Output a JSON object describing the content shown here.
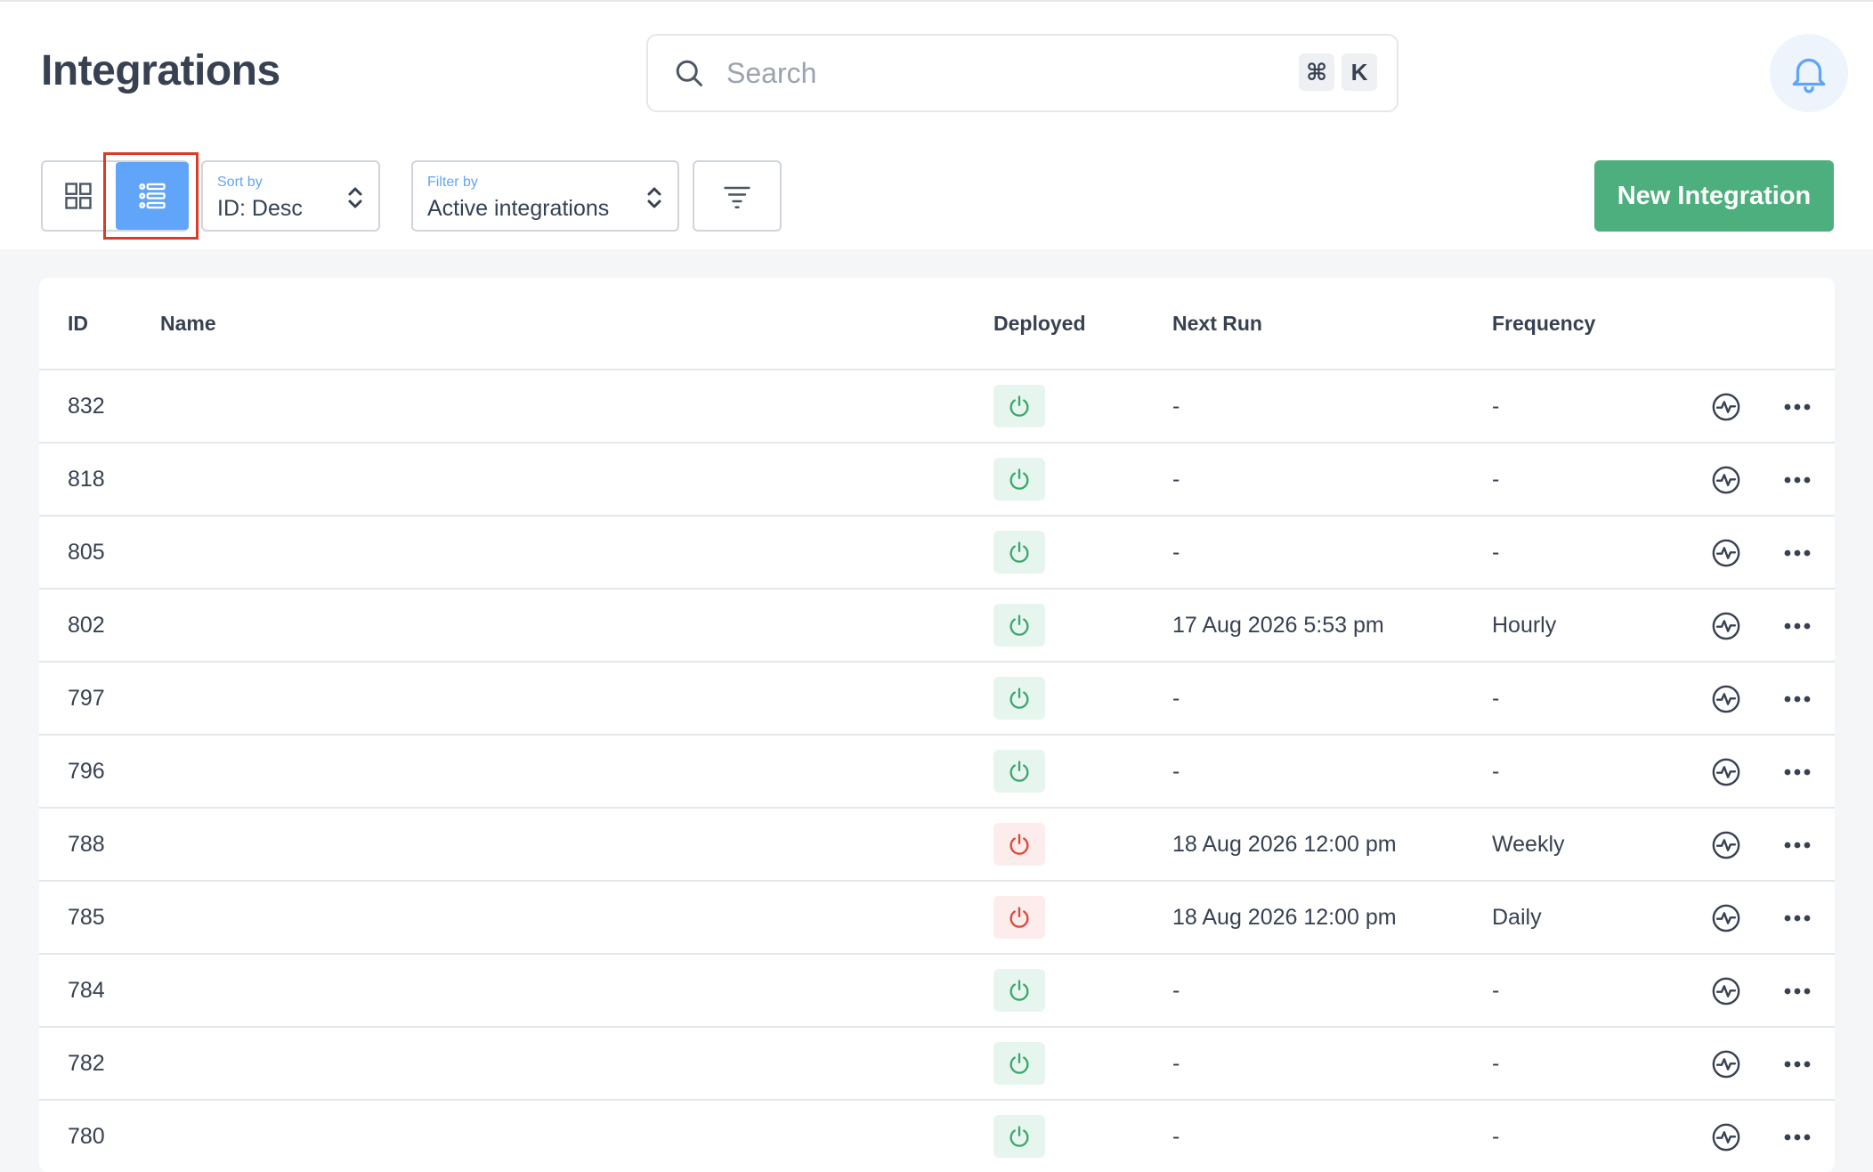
{
  "header": {
    "title": "Integrations",
    "search": {
      "placeholder": "Search",
      "value": "",
      "shortcut_keys": [
        "⌘",
        "K"
      ]
    }
  },
  "toolbar": {
    "view_modes": [
      "grid",
      "list"
    ],
    "active_view": "list",
    "sort": {
      "label": "Sort by",
      "value": "ID: Desc"
    },
    "filter": {
      "label": "Filter by",
      "value": "Active integrations"
    },
    "new_button_label": "New Integration"
  },
  "table": {
    "columns": [
      "ID",
      "Name",
      "Deployed",
      "Next Run",
      "Frequency"
    ],
    "rows": [
      {
        "id": "832",
        "name": "",
        "deployed": true,
        "next_run": "-",
        "frequency": "-"
      },
      {
        "id": "818",
        "name": "",
        "deployed": true,
        "next_run": "-",
        "frequency": "-"
      },
      {
        "id": "805",
        "name": "",
        "deployed": true,
        "next_run": "-",
        "frequency": "-"
      },
      {
        "id": "802",
        "name": "",
        "deployed": true,
        "next_run": "17 Aug 2026 5:53 pm",
        "frequency": "Hourly"
      },
      {
        "id": "797",
        "name": "",
        "deployed": true,
        "next_run": "-",
        "frequency": "-"
      },
      {
        "id": "796",
        "name": "",
        "deployed": true,
        "next_run": "-",
        "frequency": "-"
      },
      {
        "id": "788",
        "name": "",
        "deployed": false,
        "next_run": "18 Aug 2026 12:00 pm",
        "frequency": "Weekly"
      },
      {
        "id": "785",
        "name": "",
        "deployed": false,
        "next_run": "18 Aug 2026 12:00 pm",
        "frequency": "Daily"
      },
      {
        "id": "784",
        "name": "",
        "deployed": true,
        "next_run": "-",
        "frequency": "-"
      },
      {
        "id": "782",
        "name": "",
        "deployed": true,
        "next_run": "-",
        "frequency": "-"
      },
      {
        "id": "780",
        "name": "",
        "deployed": true,
        "next_run": "-",
        "frequency": "-"
      }
    ]
  },
  "colors": {
    "accent": "#60a5fa",
    "primary_button": "#4caf7d",
    "deployed_on": "#3aa76d",
    "deployed_off": "#e0453a",
    "highlight": "#dc3b26"
  }
}
